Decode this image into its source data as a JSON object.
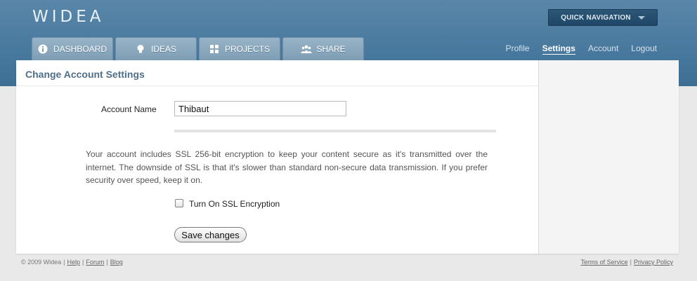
{
  "header": {
    "logo": "WIDEA",
    "quick_nav_label": "QUICK NAVIGATION"
  },
  "tabs": [
    {
      "label": "DASHBOARD",
      "icon": "info-icon"
    },
    {
      "label": "IDEAS",
      "icon": "lightbulb-icon"
    },
    {
      "label": "PROJECTS",
      "icon": "grid-icon"
    },
    {
      "label": "SHARE",
      "icon": "people-icon"
    }
  ],
  "top_links": {
    "profile": "Profile",
    "settings": "Settings",
    "account": "Account",
    "logout": "Logout",
    "active": "Settings"
  },
  "main": {
    "title": "Change Account Settings",
    "account_name_label": "Account Name",
    "account_name_value": "Thibaut",
    "description": "Your account includes SSL 256-bit encryption to keep your content secure as it's transmitted over the internet. The downside of SSL is that it's slower than standard non-secure data transmission. If you prefer security over speed, keep it on.",
    "ssl_checkbox_label": "Turn On SSL Encryption",
    "ssl_checked": false,
    "save_label": "Save changes"
  },
  "footer": {
    "copyright": "© 2009 Widea",
    "help": "Help",
    "forum": "Forum",
    "blog": "Blog",
    "terms": "Terms of Service",
    "privacy": "Privacy Policy",
    "separator": "|"
  },
  "colors": {
    "header_blue": "#4d7da1",
    "title_blue": "#4f6f88",
    "quick_nav_dark": "#1f4666"
  }
}
